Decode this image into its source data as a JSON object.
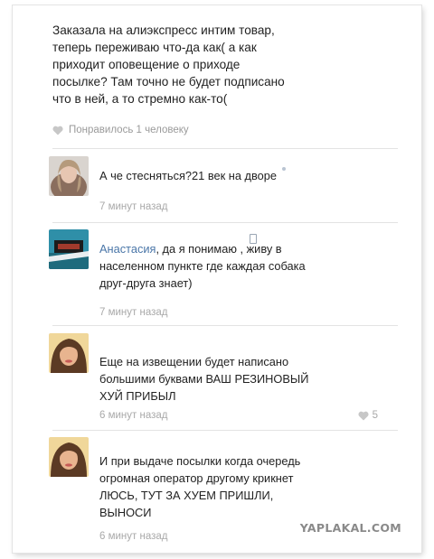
{
  "post": {
    "text": "Заказала на алиэкспресс интим товар,\nтеперь переживаю что-да как( а как\nприходит оповещение о приходе\nпосылке? Там точно не будет подписано\nчто в ней, а то стремно как-то(",
    "likes_label": "Понравилось 1 человеку"
  },
  "comments": [
    {
      "text": "А че стесняться?21 век на дворе",
      "time": "7 минут назад"
    },
    {
      "reply_to": "Анастасия",
      "text": ", да я понимаю , живу в\nнаселенном пункте где каждая собака\nдруг-друга знает)",
      "time": "7 минут назад"
    },
    {
      "text": "Еще на извещении будет написано\nбольшими буквами ВАШ РЕЗИНОВЫЙ\nХУЙ ПРИБЫЛ",
      "time": "6 минут назад",
      "likes": "5"
    },
    {
      "text": "И при выдаче посылки когда очередь\nогромная оператор другому крикнет\nЛЮСЬ, ТУТ ЗА ХУЕМ ПРИШЛИ,\nВЫНОСИ",
      "time": "6 минут назад"
    }
  ],
  "watermark": "YAPLAKAL.COM",
  "colors": {
    "link": "#4a76a8",
    "muted": "#a9a9a9",
    "divider": "#e3e3e3"
  }
}
